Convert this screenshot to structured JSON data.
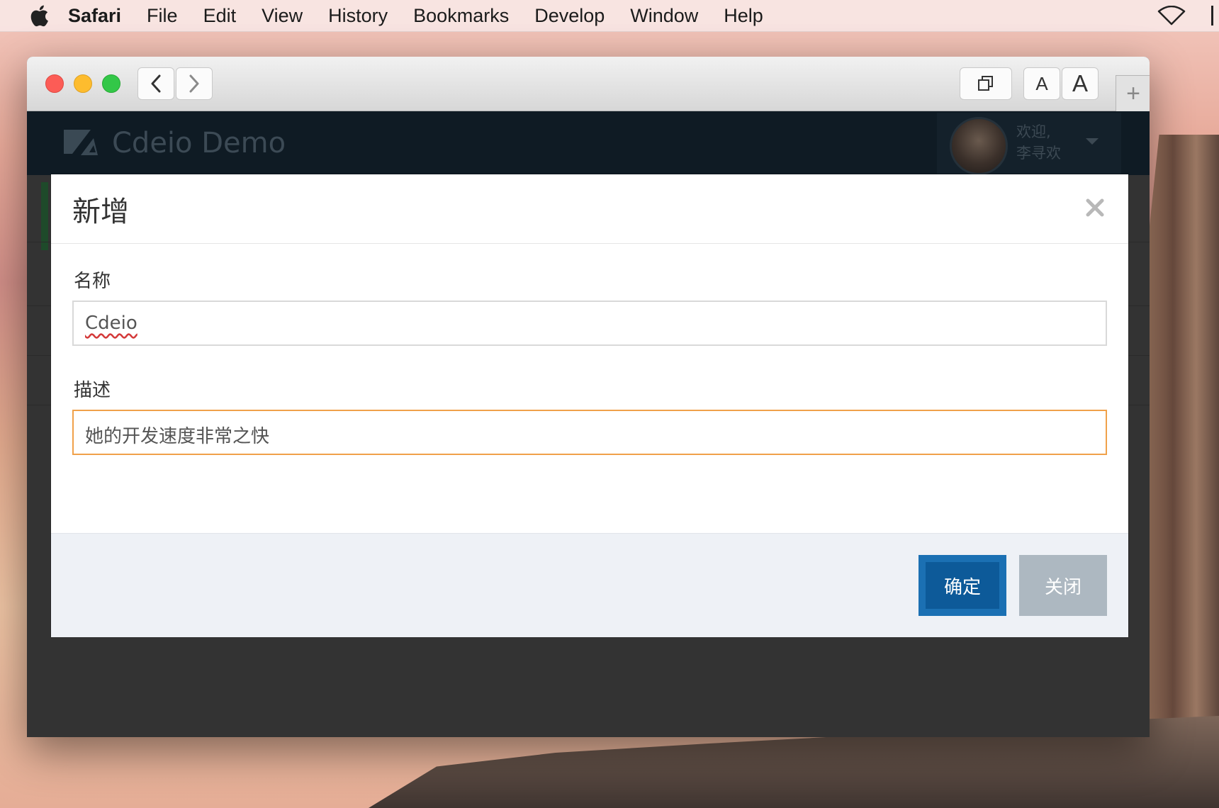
{
  "menubar": {
    "app": "Safari",
    "items": [
      "File",
      "Edit",
      "View",
      "History",
      "Bookmarks",
      "Develop",
      "Window",
      "Help"
    ]
  },
  "toolbar": {
    "font_small": "A",
    "font_large": "A",
    "new_tab": "+"
  },
  "app": {
    "title": "Cdeio Demo",
    "welcome_line1": "欢迎,",
    "welcome_line2": "李寻欢"
  },
  "modal": {
    "title": "新增",
    "fields": [
      {
        "label": "名称",
        "value": "Cdeio"
      },
      {
        "label": "描述",
        "value": "她的开发速度非常之快"
      }
    ],
    "confirm_label": "确定",
    "close_label": "关闭"
  },
  "colors": {
    "primary": "#1b70b3",
    "focus_border": "#f0a14a",
    "secondary_button": "#adb8c1",
    "header_bg": "#0f1b24"
  },
  "icons": [
    "apple-icon",
    "wifi-icon",
    "back-icon",
    "forward-icon",
    "tabs-icon",
    "close-icon",
    "logo-icon",
    "avatar",
    "caret-down-icon"
  ]
}
